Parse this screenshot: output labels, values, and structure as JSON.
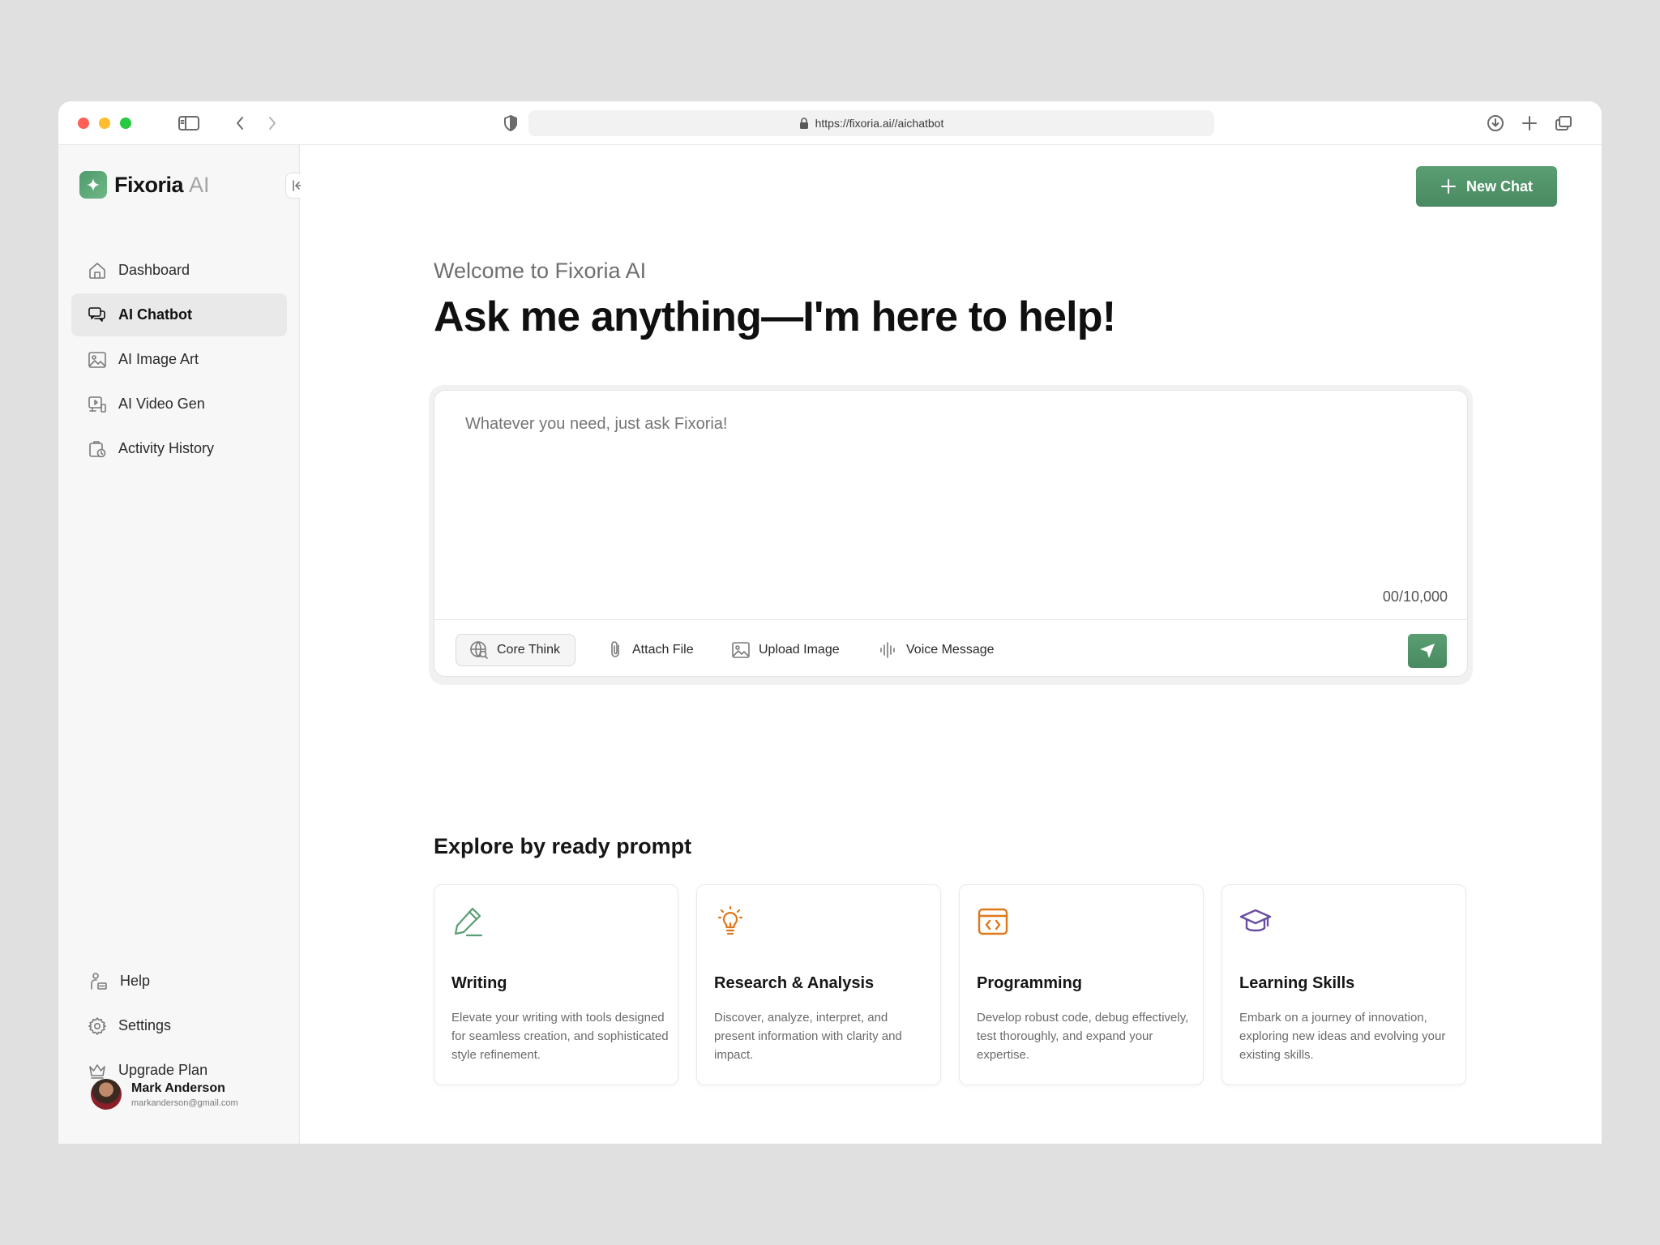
{
  "browser": {
    "url": "https://fixoria.ai//aichatbot"
  },
  "sidebar": {
    "brand": "Fixoria",
    "brand_suffix": "AI",
    "nav": [
      {
        "label": "Dashboard",
        "icon": "home-icon"
      },
      {
        "label": "AI Chatbot",
        "icon": "chat-icon",
        "active": true
      },
      {
        "label": "AI Image Art",
        "icon": "image-icon"
      },
      {
        "label": "AI Video Gen",
        "icon": "video-icon"
      },
      {
        "label": "Activity History",
        "icon": "history-icon"
      }
    ],
    "bottom_nav": [
      {
        "label": "Help",
        "icon": "help-icon"
      },
      {
        "label": "Settings",
        "icon": "gear-icon"
      },
      {
        "label": "Upgrade Plan",
        "icon": "crown-icon"
      }
    ],
    "user": {
      "name": "Mark Anderson",
      "email": "markanderson@gmail.com"
    }
  },
  "main": {
    "new_chat_label": "New Chat",
    "welcome": "Welcome to Fixoria AI",
    "headline": "Ask me anything—I'm here to help!",
    "composer": {
      "placeholder": "Whatever you need, just ask Fixoria!",
      "counter": "00/10,000",
      "tools": {
        "core_think": "Core Think",
        "attach_file": "Attach File",
        "upload_image": "Upload Image",
        "voice_message": "Voice Message"
      }
    },
    "explore_title": "Explore by ready prompt",
    "cards": [
      {
        "title": "Writing",
        "desc": "Elevate your writing with tools designed for seamless creation, and sophisticated style refinement.",
        "icon": "pen-icon",
        "color": "#5a9e72"
      },
      {
        "title": "Research & Analysis",
        "desc": "Discover, analyze, interpret, and present information with clarity and impact.",
        "icon": "lightbulb-icon",
        "color": "#e0781a"
      },
      {
        "title": "Programming",
        "desc": "Develop robust code, debug effectively, test thoroughly, and expand your expertise.",
        "icon": "code-icon",
        "color": "#e0781a"
      },
      {
        "title": "Learning Skills",
        "desc": "Embark on a journey of innovation, exploring new ideas and evolving your existing skills.",
        "icon": "graduation-cap-icon",
        "color": "#6a4fa0"
      }
    ]
  },
  "colors": {
    "accent": "#4e9a6c",
    "sidebar_bg": "#f7f7f7",
    "page_bg": "#e0e0e0"
  }
}
